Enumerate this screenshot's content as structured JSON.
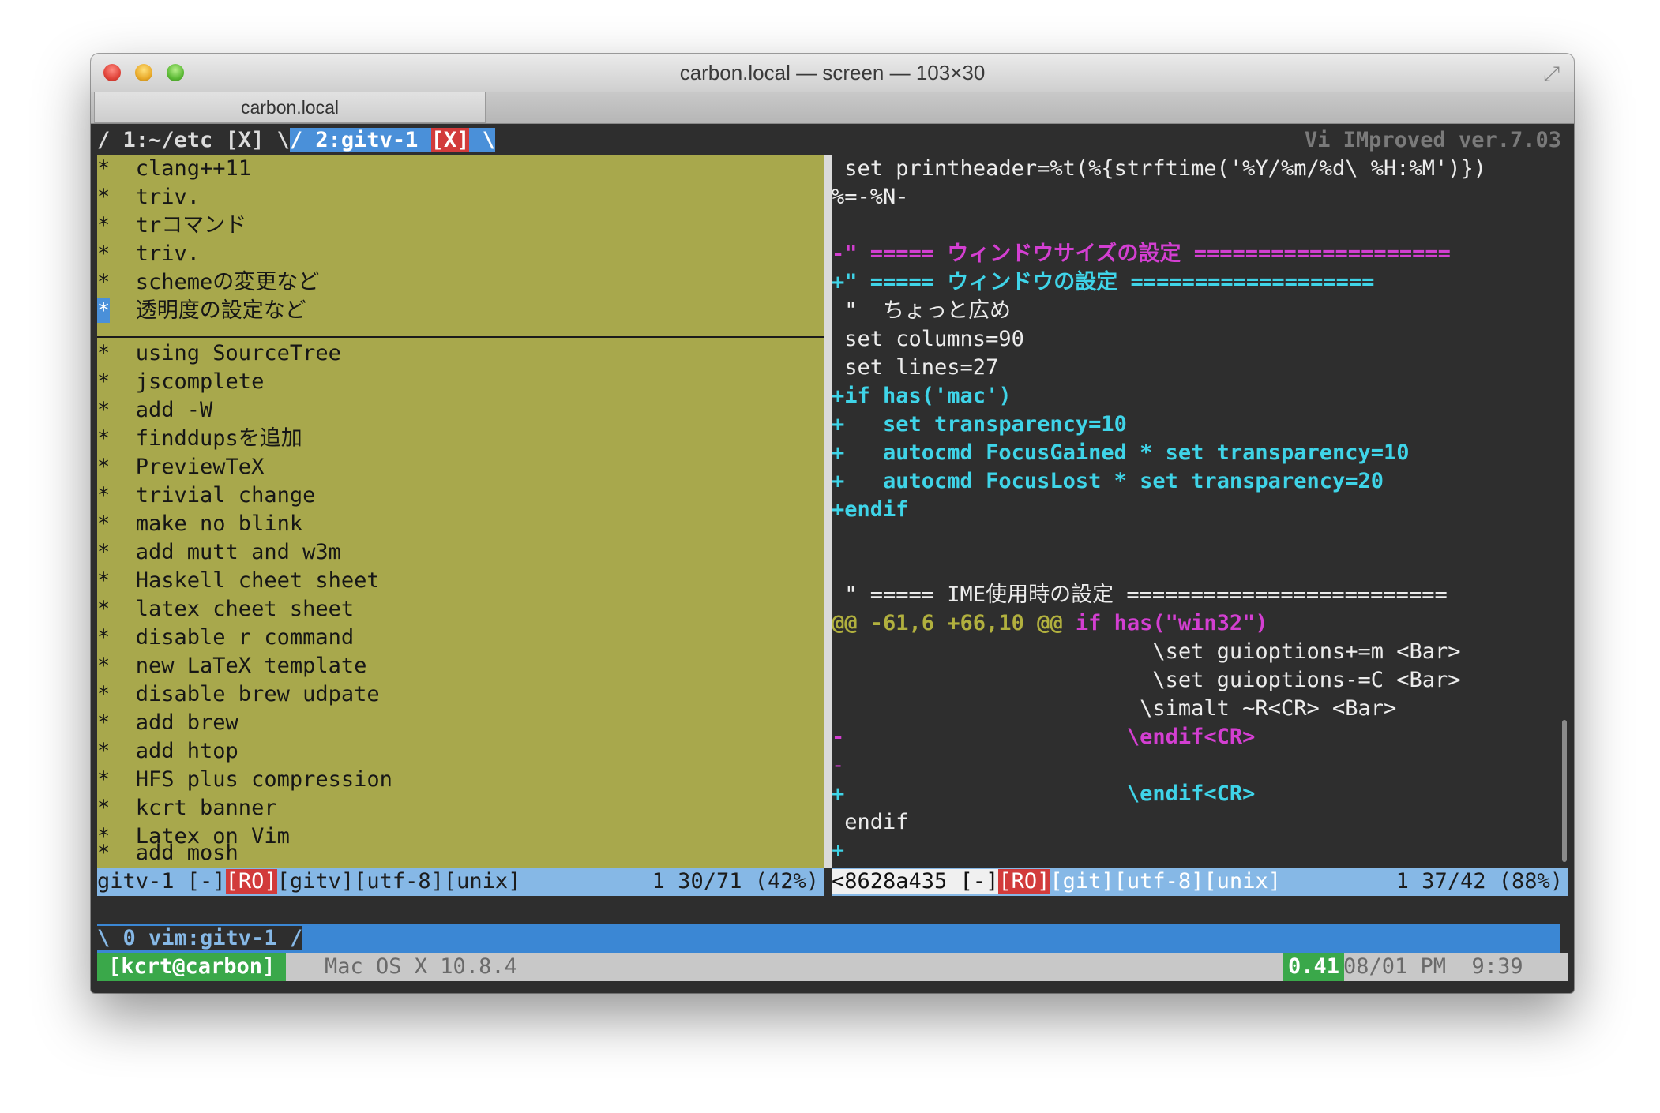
{
  "window": {
    "title": "carbon.local — screen — 103×30",
    "tab_label": "carbon.local"
  },
  "tabline": {
    "tab1": "/ 1:~/etc [X] \\",
    "tab2": "/ 2:gitv-1 ",
    "tab2_close": "[X]",
    "tab2_end": " \\",
    "vim_title": "Vi IMproved ver.7.03"
  },
  "left_pane": {
    "lines": [
      "*  clang++11",
      "*  triv.",
      "*  trコマンド",
      "*  triv.",
      "*  schemeの変更など",
      "*  透明度の設定など",
      "*  using SourceTree",
      "*  jscomplete",
      "*  add -W",
      "*  finddupsを追加",
      "*  PreviewTeX",
      "*  trivial change",
      "*  make no blink",
      "*  add mutt and w3m",
      "*  Haskell cheet sheet",
      "*  latex cheet sheet",
      "*  disable r command",
      "*  new LaTeX template",
      "*  disable brew udpate",
      "*  add brew",
      "*  add htop",
      "*  HFS plus compression",
      "*  kcrt banner",
      "*  Latex on Vim",
      "*  add mosh"
    ],
    "cursor_star": "*",
    "cursor_rest": "  透明度の設定など"
  },
  "right_pane": {
    "lines": [
      " set printheader=%t(%{strftime('%Y/%m/%d\\ %H:%M')})",
      "%=-%N-",
      "",
      "-\" ===== ウィンドウサイズの設定 ====================",
      "+\" ===== ウィンドウの設定 ===================",
      " \"  ちょっと広め",
      " set columns=90",
      " set lines=27",
      "+if has('mac')",
      "+   set transparency=10",
      "+   autocmd FocusGained * set transparency=10",
      "+   autocmd FocusLost * set transparency=20",
      "+endif",
      "",
      "",
      " \" ===== IME使用時の設定 =========================",
      "@@ -61,6 +66,10 @@ if has(\"win32\")",
      "                         \\set guioptions+=m <Bar>",
      "                         \\set guioptions-=C <Bar>",
      "                        \\simalt ~R<CR> <Bar>",
      "-                      \\endif<CR>",
      "-",
      "+                      \\endif<CR>",
      " endif",
      "+"
    ],
    "hunk_head": "@@ -61,6 +66,10 @@ ",
    "hunk_tail": "if has(\"win32\")"
  },
  "statusline": {
    "left_name": "gitv-1 [-]",
    "left_ro": "[RO]",
    "left_rest": "[gitv][utf-8][unix]",
    "left_pos": "1 30/71 (42%)",
    "right_name": "<8628a435 [-]",
    "right_ro": "[RO]",
    "right_rest": "[git][utf-8][unix]",
    "right_pos": "1 37/42 (88%)"
  },
  "screen_bar": {
    "window": "\\ 0 vim:gitv-1 /"
  },
  "hardstatus": {
    "user": "[kcrt@carbon]",
    "os": "Mac OS X 10.8.4",
    "load": "0.41",
    "datetime": "08/01 PM  9:39"
  }
}
